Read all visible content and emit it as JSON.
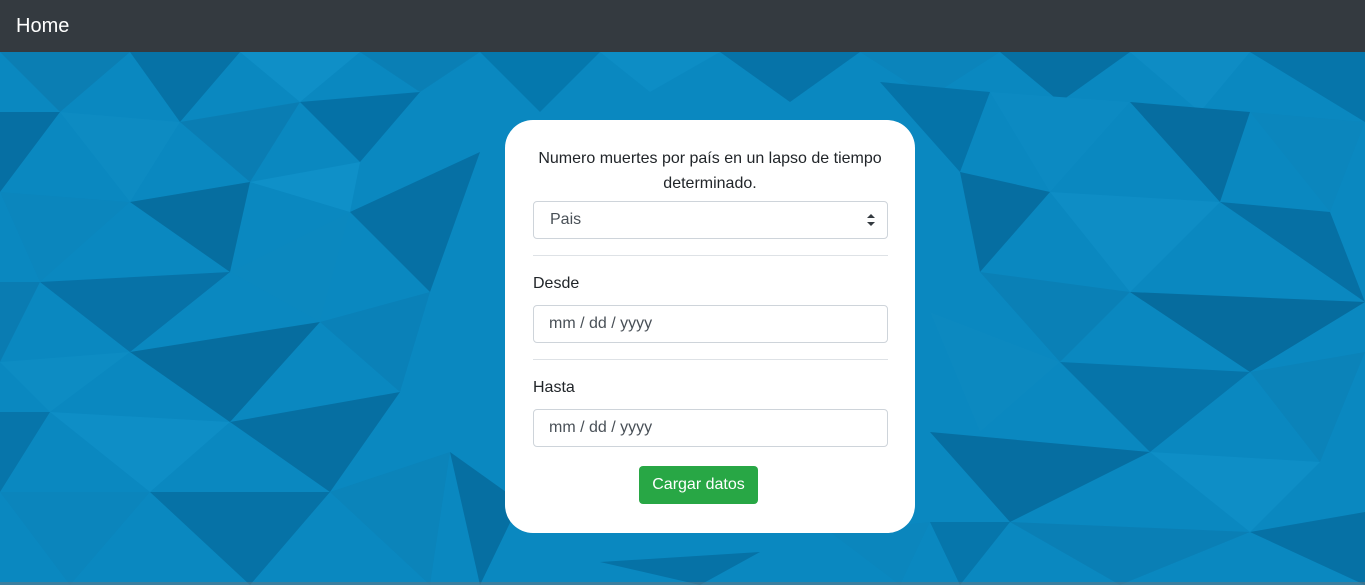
{
  "navbar": {
    "brand": "Home"
  },
  "form": {
    "title": "Numero muertes por país en un lapso de tiempo determinado.",
    "country_select": {
      "selected": "Pais"
    },
    "from": {
      "label": "Desde",
      "placeholder": "mm / dd / yyyy"
    },
    "to": {
      "label": "Hasta",
      "placeholder": "mm / dd / yyyy"
    },
    "submit_label": "Cargar datos"
  },
  "colors": {
    "navbar": "#343a40",
    "background": "#0a88c0",
    "button": "#28a745"
  }
}
